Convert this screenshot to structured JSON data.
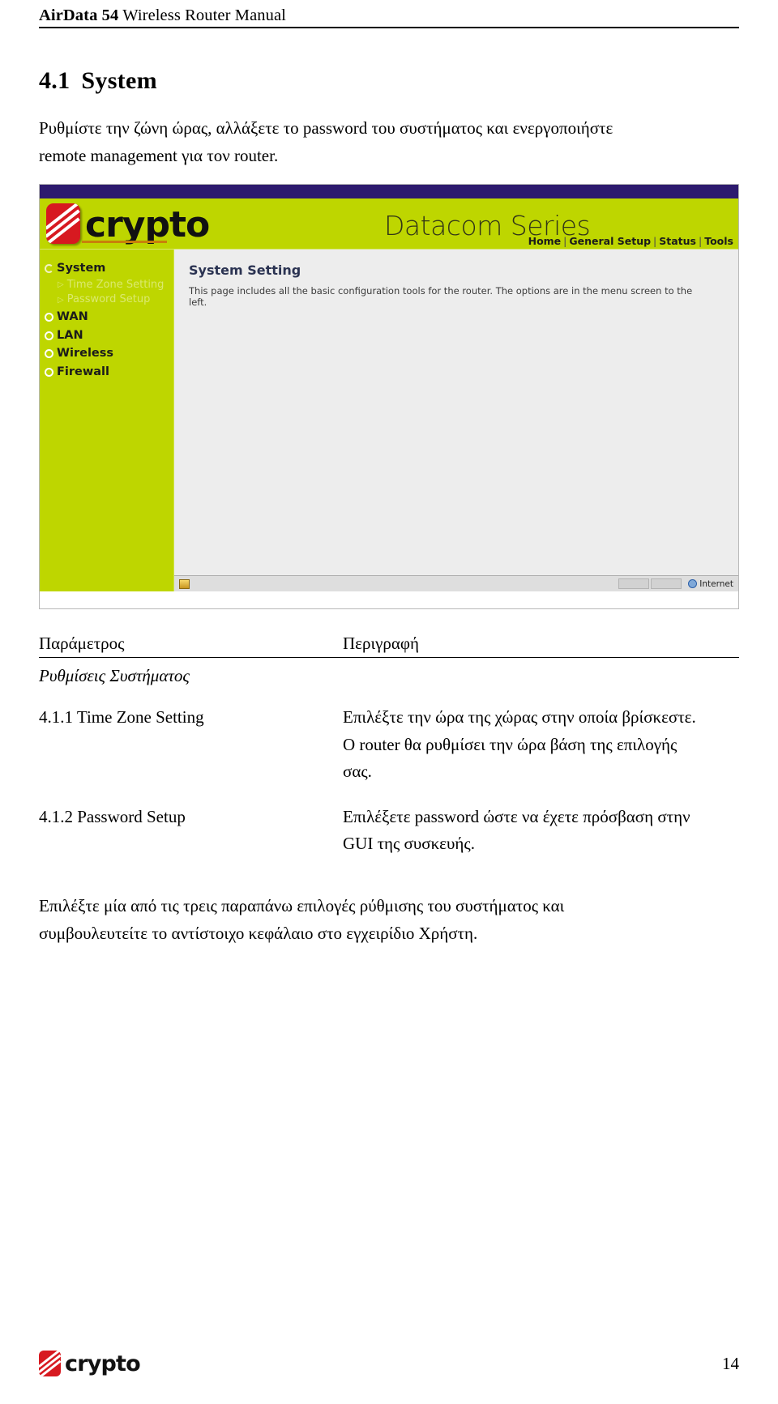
{
  "document": {
    "running_header_bold": "AirData 54",
    "running_header_rest": " Wireless Router Manual",
    "page_number": "14"
  },
  "section": {
    "number": "4.1",
    "title": "System",
    "intro_line1": "Ρυθμίστε την ζώνη ώρας, αλλάξετε το password του συστήματος και ενεργοποιήστε",
    "intro_line2": "remote management για τον router."
  },
  "screenshot": {
    "brand_logo_text": "crypto",
    "brand_series": "Datacom Series",
    "nav": [
      {
        "label": "Home"
      },
      {
        "label": "General Setup"
      },
      {
        "label": "Status"
      },
      {
        "label": "Tools"
      }
    ],
    "sidebar": [
      {
        "label": "System",
        "state": "active",
        "type": "item"
      },
      {
        "label": "Time Zone Setting",
        "type": "subitem"
      },
      {
        "label": "Password Setup",
        "type": "subitem"
      },
      {
        "label": "WAN",
        "type": "item"
      },
      {
        "label": "LAN",
        "type": "item"
      },
      {
        "label": "Wireless",
        "type": "item"
      },
      {
        "label": "Firewall",
        "type": "item"
      }
    ],
    "panel_title": "System Setting",
    "panel_description": "This page includes all the basic configuration tools for the router. The options are in the menu screen to the left.",
    "status_bar_text": "Internet",
    "colors": {
      "topbar": "#2d1a6e",
      "banner": "#bed600",
      "logo_red": "#d71920",
      "panel_bg": "#ededed",
      "panel_title": "#2b3352",
      "submenu_text": "#dbe96e"
    }
  },
  "param_table": {
    "header": {
      "col1": "Παράμετρος",
      "col2": "Περιγραφή"
    },
    "group_title": "Ρυθμίσεις Συστήματος",
    "rows": [
      {
        "param": "4.1.1 Time Zone Setting",
        "description_line1": "Επιλέξτε την ώρα της χώρας στην οποία βρίσκεστε.",
        "description_line2": "Ο router θα ρυθμίσει την ώρα βάση της επιλογής",
        "description_line3": "σας."
      },
      {
        "param": "4.1.2 Password Setup",
        "description_line1": "Επιλέξετε password ώστε να έχετε πρόσβαση στην",
        "description_line2": "GUI της συσκευής.",
        "description_line3": ""
      }
    ]
  },
  "closing": {
    "line1": "Επιλέξτε μία από τις τρεις παραπάνω επιλογές ρύθμισης του συστήματος και",
    "line2": "συμβουλευτείτε το αντίστοιχο κεφάλαιο στο εγχειρίδιο Χρήστη."
  }
}
